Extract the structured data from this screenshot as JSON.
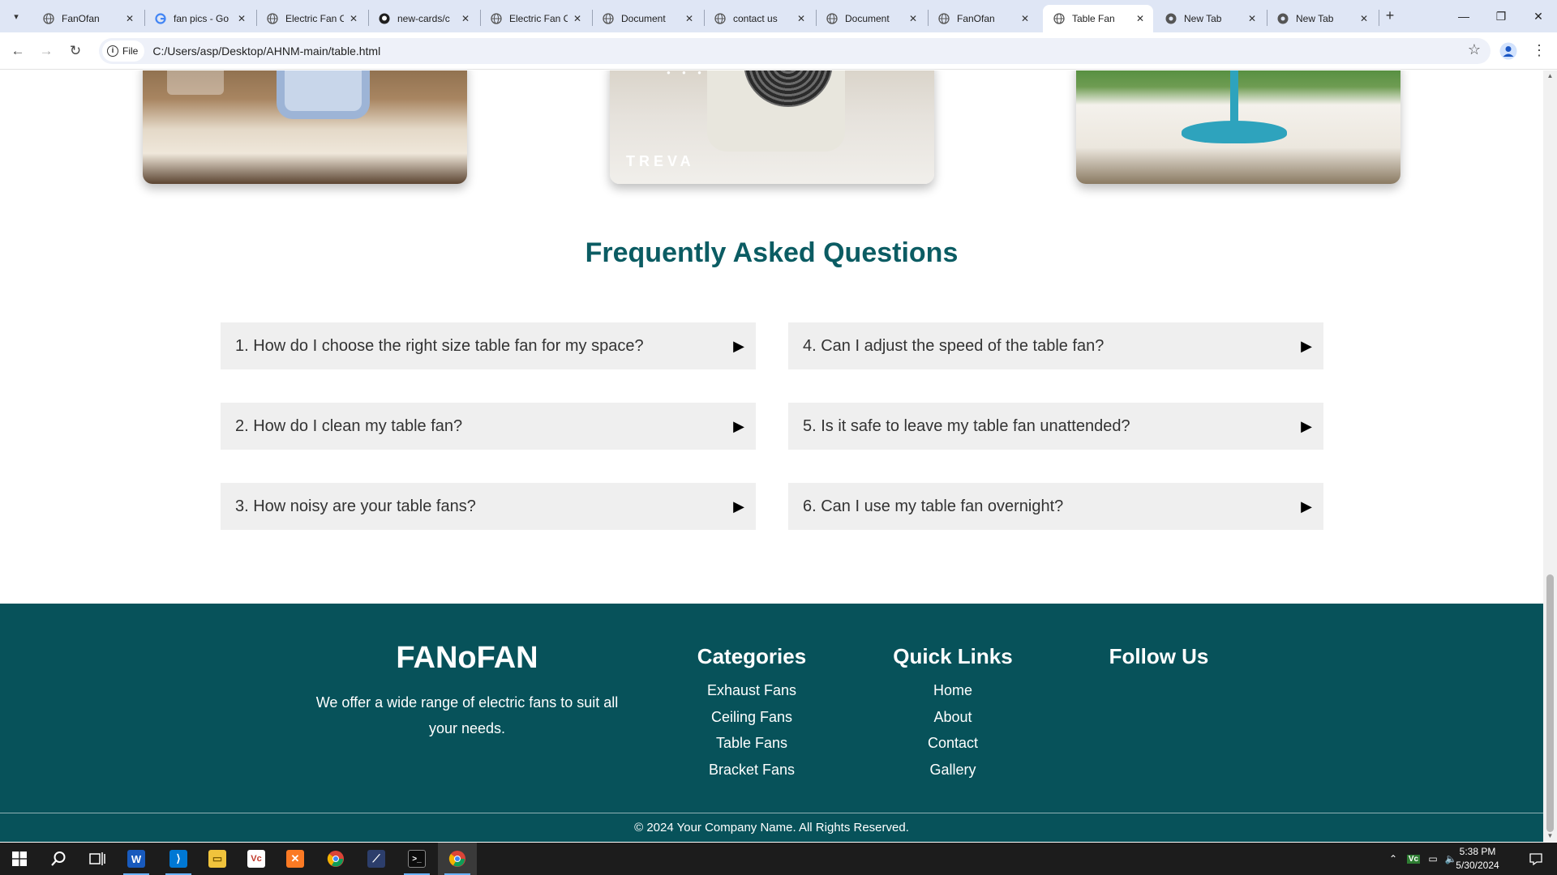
{
  "browser": {
    "tabs": [
      {
        "label": "FanOfan",
        "favicon": "globe-icon",
        "active": false
      },
      {
        "label": "fan pics - Go",
        "favicon": "google-icon",
        "active": false
      },
      {
        "label": "Electric Fan C",
        "favicon": "globe-icon",
        "active": false
      },
      {
        "label": "new-cards/c",
        "favicon": "github-icon",
        "active": false
      },
      {
        "label": "Electric Fan C",
        "favicon": "globe-icon",
        "active": false
      },
      {
        "label": "Document",
        "favicon": "globe-icon",
        "active": false
      },
      {
        "label": "contact us",
        "favicon": "globe-icon",
        "active": false
      },
      {
        "label": "Document",
        "favicon": "globe-icon",
        "active": false
      },
      {
        "label": "FanOfan",
        "favicon": "globe-icon",
        "active": false
      },
      {
        "label": "Table Fan",
        "favicon": "globe-icon",
        "active": true
      },
      {
        "label": "New Tab",
        "favicon": "chrome-icon",
        "active": false
      },
      {
        "label": "New Tab",
        "favicon": "chrome-icon",
        "active": false
      }
    ],
    "address": {
      "scheme_label": "File",
      "url": "C:/Users/asp/Desktop/AHNM-main/table.html"
    }
  },
  "page": {
    "product_images": [
      {
        "name": "blue-table-fan-on-counter"
      },
      {
        "name": "treva-white-desk-fan",
        "brand_text": "TREVA"
      },
      {
        "name": "teal-table-fan-on-wood"
      }
    ],
    "faq": {
      "title": "Frequently Asked Questions",
      "items": [
        {
          "question": "1. How do I choose the right size table fan for my space?"
        },
        {
          "question": "2. How do I clean my table fan?"
        },
        {
          "question": "3. How noisy are your table fans?"
        },
        {
          "question": "4. Can I adjust the speed of the table fan?"
        },
        {
          "question": "5. Is it safe to leave my table fan unattended?"
        },
        {
          "question": "6. Can I use my table fan overnight?"
        }
      ],
      "arrow_glyph": "▶"
    },
    "footer": {
      "brand": "FANoFAN",
      "description": "We offer a wide range of electric fans to suit all your needs.",
      "categories": {
        "heading": "Categories",
        "links": [
          "Exhaust Fans",
          "Ceiling Fans",
          "Table Fans",
          "Bracket Fans"
        ]
      },
      "quick_links": {
        "heading": "Quick Links",
        "links": [
          "Home",
          "About",
          "Contact",
          "Gallery"
        ]
      },
      "follow_us": {
        "heading": "Follow Us"
      },
      "copyright": "© 2024 Your Company Name. All Rights Reserved."
    },
    "colors": {
      "accent": "#0b5c63",
      "footer_bg": "#07525a",
      "faq_bg": "#efefef"
    }
  },
  "taskbar": {
    "apps": [
      "start-icon",
      "search-icon",
      "task-view-icon",
      "word-icon",
      "vscode-icon",
      "file-explorer-icon",
      "vc-icon",
      "xampp-icon",
      "chrome-icon",
      "ide-icon",
      "terminal-icon",
      "chrome-active-icon"
    ],
    "clock": {
      "time": "5:38 PM",
      "date": "5/30/2024"
    }
  }
}
